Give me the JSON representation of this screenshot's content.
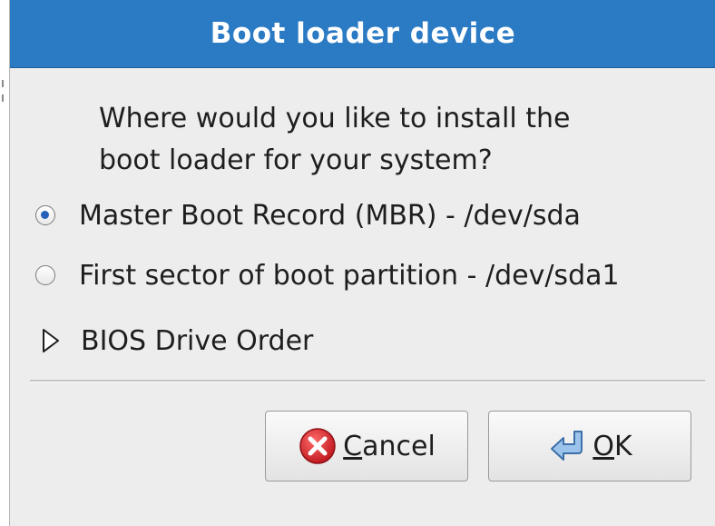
{
  "dialog": {
    "title": "Boot loader device",
    "question_line1": "Where would you like to install the",
    "question_line2": "boot loader for your system?",
    "options": [
      {
        "label": "Master Boot Record (MBR) - /dev/sda",
        "selected": true
      },
      {
        "label": "First sector of boot partition - /dev/sda1",
        "selected": false
      }
    ],
    "expander": {
      "label": "BIOS Drive Order",
      "expanded": false
    },
    "buttons": {
      "cancel": {
        "mnemonic": "C",
        "rest": "ancel",
        "icon": "cancel-icon"
      },
      "ok": {
        "mnemonic": "O",
        "rest": "K",
        "icon": "ok-return-icon"
      }
    }
  },
  "colors": {
    "titlebar": "#2a7ac4",
    "dialog_bg": "#ededed",
    "radio_selected": "#2560b8",
    "cancel_icon": "#d8262c"
  }
}
